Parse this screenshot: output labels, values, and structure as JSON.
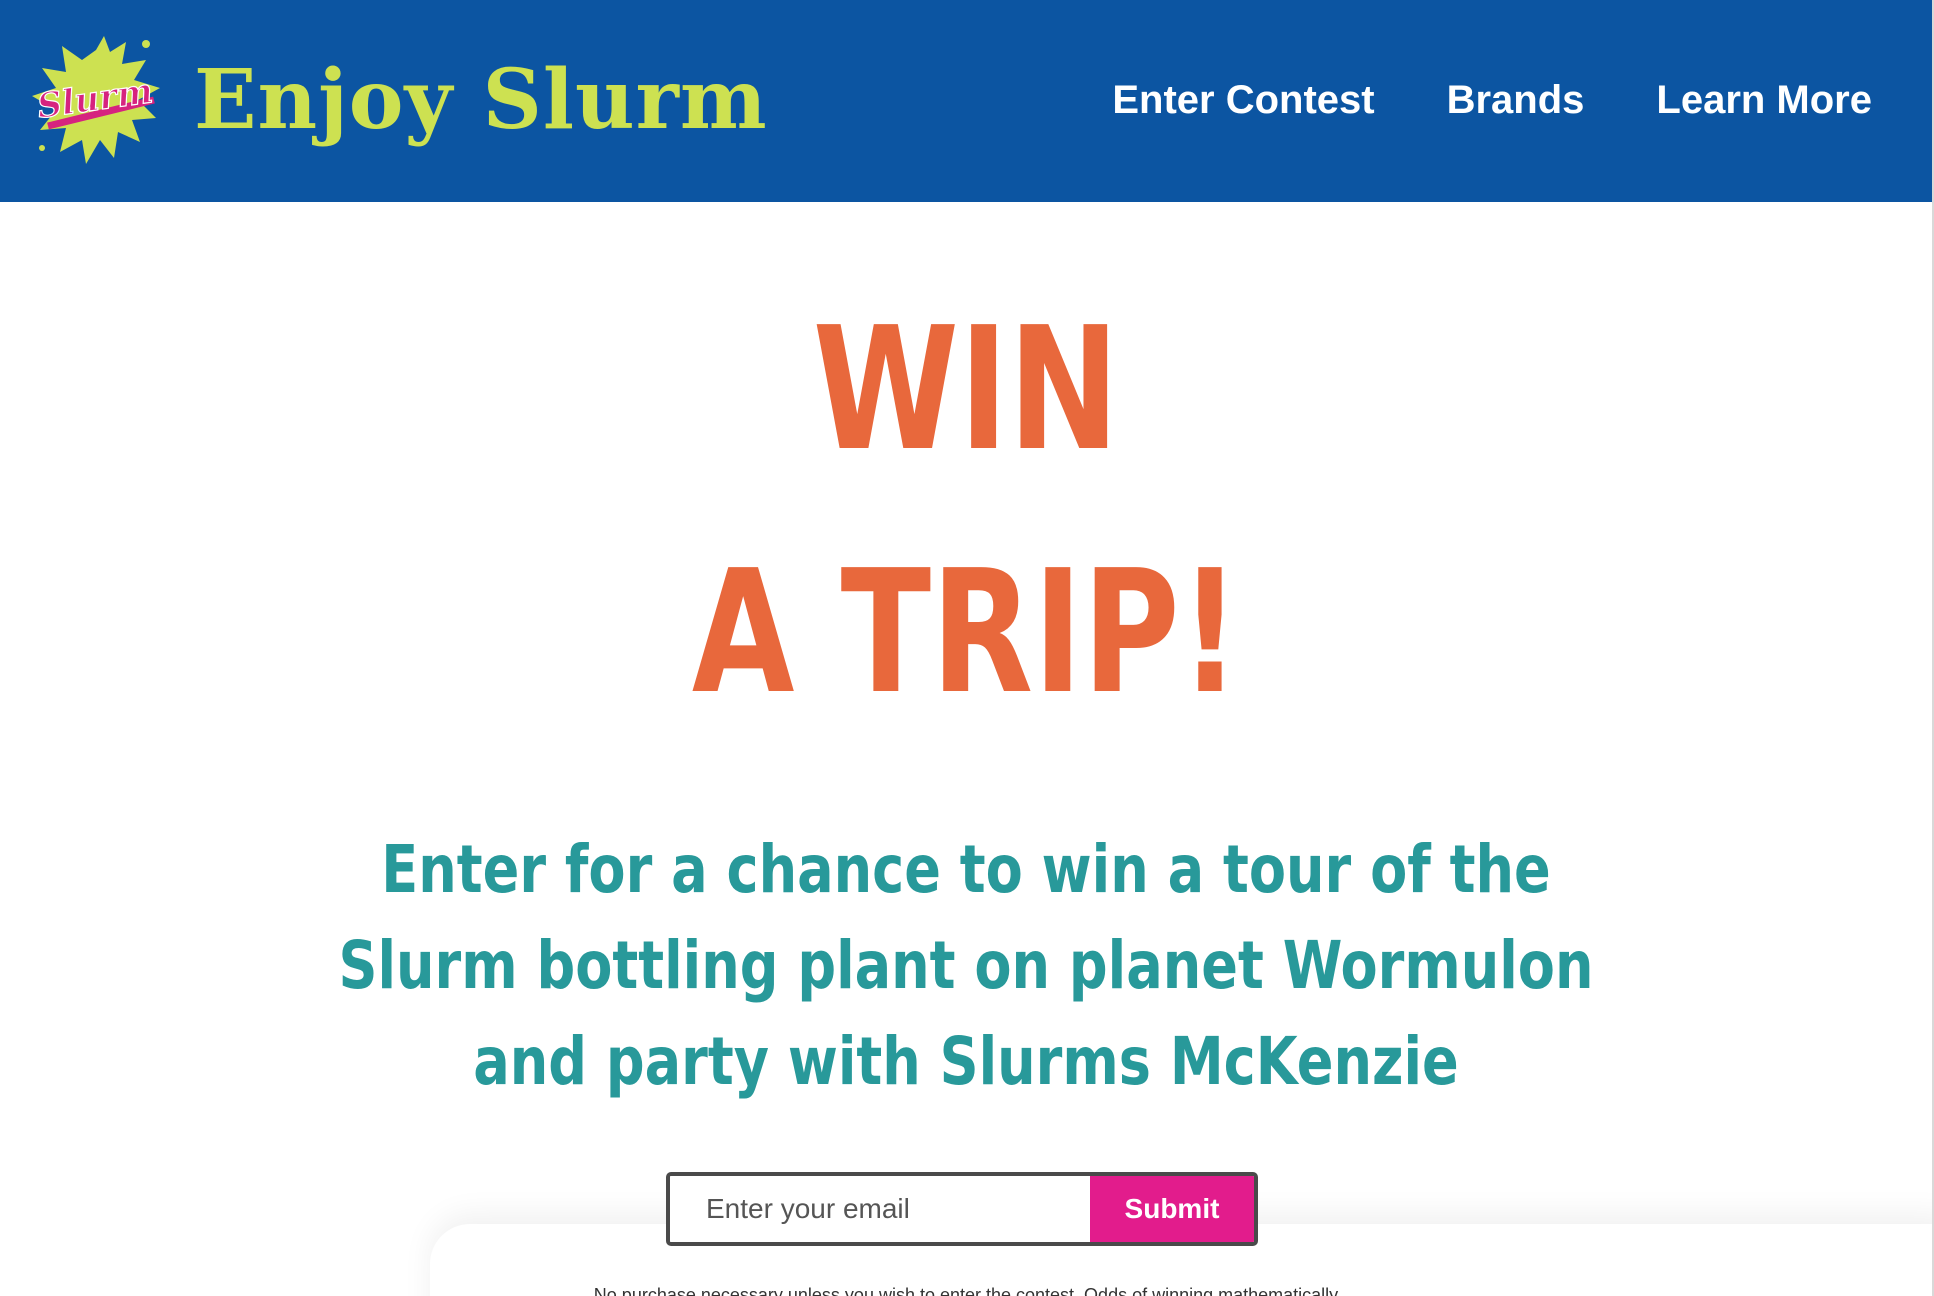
{
  "header": {
    "logo_text": "Slurm",
    "title": "Enjoy Slurm",
    "nav": [
      {
        "label": "Enter Contest"
      },
      {
        "label": "Brands"
      },
      {
        "label": "Learn More"
      }
    ]
  },
  "hero": {
    "headline_line1": "WIN",
    "headline_line2": "A TRIP!",
    "subtext": "Enter for a chance to win a tour of the Slurm bottling plant on planet Wormulon and party with Slurms McKenzie"
  },
  "signup": {
    "email_placeholder": "Enter your email",
    "submit_label": "Submit"
  },
  "disclaimer": "No purchase necessary unless you wish to enter the contest. Odds of winning mathematically",
  "colors": {
    "header_bg": "#0c55a2",
    "brand_lime": "#cde151",
    "headline_orange": "#e8683c",
    "subtext_teal": "#28999a",
    "submit_pink": "#e21c8c",
    "logo_pink": "#d6237f"
  }
}
